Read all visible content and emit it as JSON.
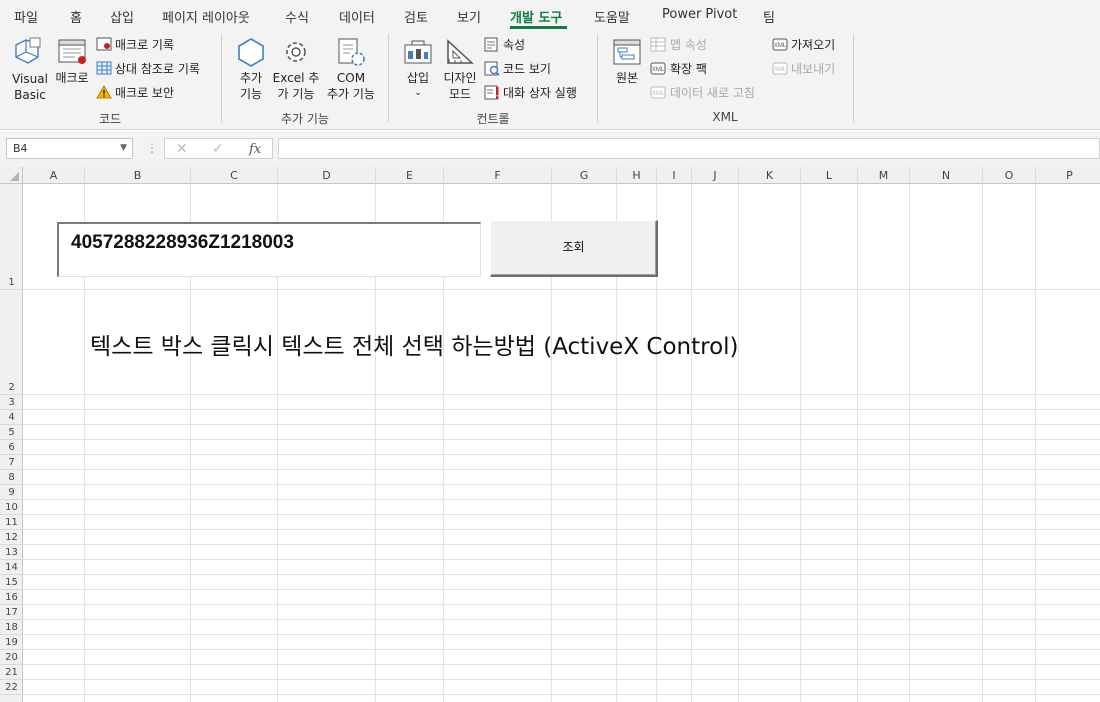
{
  "tabs": [
    "파일",
    "홈",
    "삽입",
    "페이지 레이아웃",
    "수식",
    "데이터",
    "검토",
    "보기",
    "개발 도구",
    "도움말",
    "Power Pivot",
    "팀"
  ],
  "active_tab": "개발 도구",
  "ribbon": {
    "code": {
      "group_label": "코드",
      "visual_basic": "Visual\nBasic",
      "macro": "매크로",
      "record_macro": "매크로 기록",
      "relative_ref": "상대 참조로 기록",
      "macro_security": "매크로 보안"
    },
    "addins": {
      "group_label": "추가 기능",
      "addins": "추가\n기능",
      "excel_addins": "Excel 추\n가 기능",
      "com_addins": "COM\n추가 기능"
    },
    "controls": {
      "group_label": "컨트롤",
      "insert": "삽입",
      "design_mode": "디자인\n모드",
      "properties": "속성",
      "view_code": "코드 보기",
      "run_dialog": "대화 상자 실행"
    },
    "xml": {
      "group_label": "XML",
      "source": "원본",
      "map_properties": "맵 속성",
      "expansion_packs": "확장 팩",
      "refresh_data": "데이터 새로 고침",
      "import": "가져오기",
      "export": "내보내기"
    }
  },
  "formula_bar": {
    "name_box": "B4",
    "fx": "fx",
    "value": ""
  },
  "columns": [
    "A",
    "B",
    "C",
    "D",
    "E",
    "F",
    "G",
    "H",
    "I",
    "J",
    "K",
    "L",
    "M",
    "N",
    "O",
    "P"
  ],
  "rows": [
    "1",
    "2",
    "3",
    "4",
    "5",
    "6",
    "7",
    "8",
    "9",
    "10",
    "11",
    "12",
    "13",
    "14",
    "15",
    "16",
    "17",
    "18",
    "19",
    "20",
    "21",
    "22"
  ],
  "sheet": {
    "textbox_value": "4057288228936Z1218003",
    "lookup_button": "조회",
    "caption": "텍스트 박스 클릭시 텍스트 전체 선택 하는방법 (ActiveX Control)"
  }
}
